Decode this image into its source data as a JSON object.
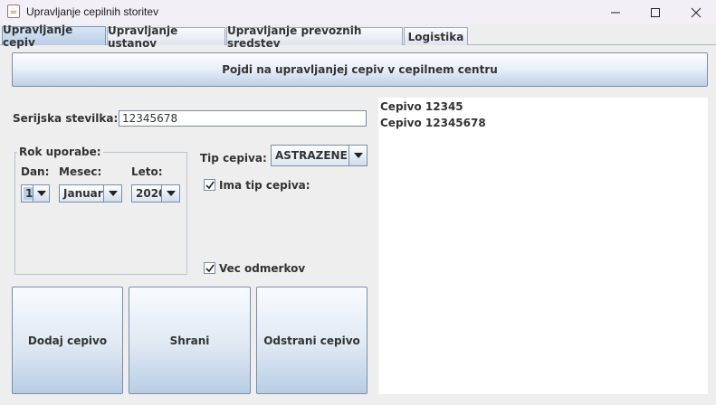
{
  "window": {
    "title": "Upravljanje cepilnih storitev",
    "icon": "java-icon"
  },
  "tabs": [
    {
      "label": "Upravljanje cepiv",
      "active": true
    },
    {
      "label": "Upravljanje ustanov",
      "active": false
    },
    {
      "label": "Upravljanje prevoznih sredstev",
      "active": false
    },
    {
      "label": "Logistika",
      "active": false
    }
  ],
  "top_button_label": "Pojdi na upravljanjej cepiv v cepilnem centru",
  "serial": {
    "label": "Serijska stevilka:",
    "value": "12345678"
  },
  "expiry": {
    "group_title": "Rok uporabe:",
    "day_label": "Dan:",
    "month_label": "Mesec:",
    "year_label": "Leto:",
    "day_value": "1",
    "month_value": "Januar",
    "year_value": "2020"
  },
  "vaccine_type": {
    "label": "Tip cepiva:",
    "value": "ASTRAZENE..."
  },
  "checkboxes": {
    "has_type_label": "Ima tip cepiva:",
    "has_type_checked": true,
    "multi_dose_label": "Vec odmerkov",
    "multi_dose_checked": true
  },
  "actions": {
    "add_label": "Dodaj cepivo",
    "save_label": "Shrani",
    "remove_label": "Odstrani cepivo"
  },
  "vaccine_list": [
    "Cepivo 12345",
    "Cepivo 12345678"
  ],
  "colors": {
    "accent": "#b8cde6",
    "background": "#eeeeee"
  }
}
